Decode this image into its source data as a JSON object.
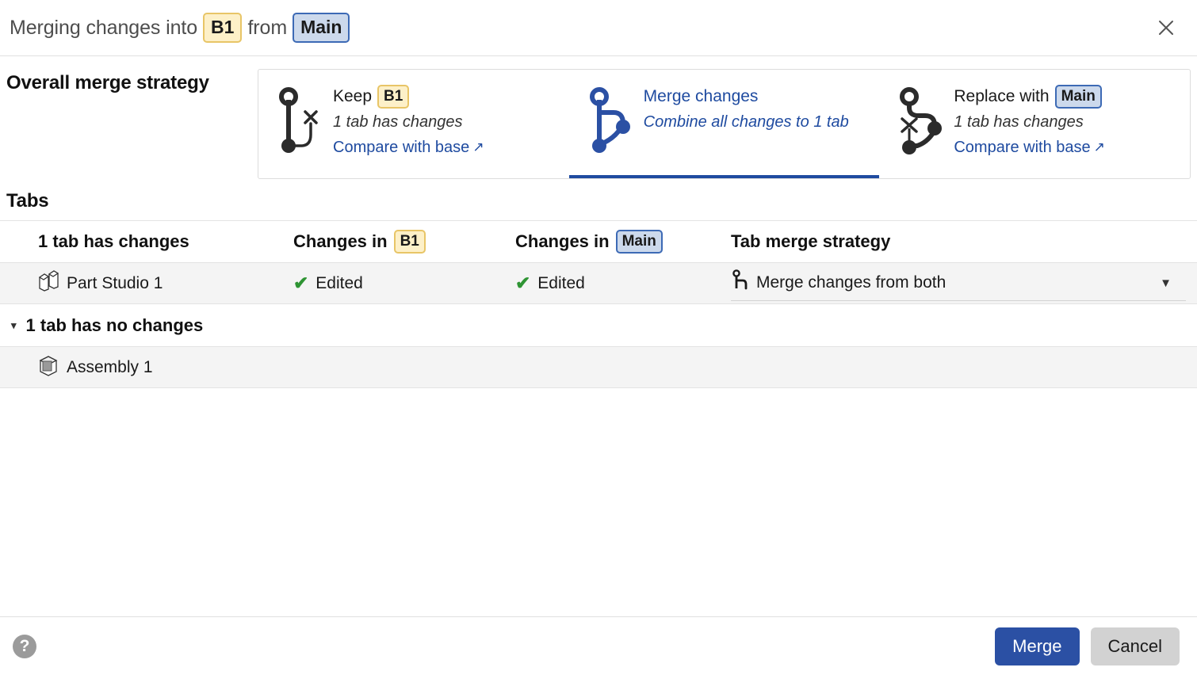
{
  "header": {
    "prefix": "Merging changes into",
    "target_branch": "B1",
    "middle": "from",
    "source_branch": "Main",
    "close_icon": "close-icon"
  },
  "strategy": {
    "label": "Overall merge strategy",
    "options": [
      {
        "id": "keep-b1",
        "title_prefix": "Keep",
        "badge": "B1",
        "badge_style": "yellow",
        "subtitle": "1 tab has changes",
        "link": "Compare with base",
        "link_arrow": "↗",
        "selected": false,
        "icon": "branch-discard-right-icon"
      },
      {
        "id": "merge-changes",
        "title_prefix": "Merge changes",
        "badge": "",
        "badge_style": "none",
        "subtitle": "Combine all changes to 1 tab",
        "link": "",
        "link_arrow": "",
        "selected": true,
        "icon": "branch-merge-icon"
      },
      {
        "id": "replace-with-main",
        "title_prefix": "Replace with",
        "badge": "Main",
        "badge_style": "blue",
        "subtitle": "1 tab has changes",
        "link": "Compare with base",
        "link_arrow": "↗",
        "selected": false,
        "icon": "branch-discard-left-icon"
      }
    ]
  },
  "tabs_section": {
    "heading": "Tabs",
    "columns": {
      "c1": "1 tab has changes",
      "c2_prefix": "Changes in",
      "c2_badge": "B1",
      "c3_prefix": "Changes in",
      "c3_badge": "Main",
      "c4": "Tab merge strategy"
    },
    "changed_rows": [
      {
        "name": "Part Studio 1",
        "icon": "part-studio-icon",
        "change_b1": "Edited",
        "change_main": "Edited",
        "status_icon": "check-icon",
        "strategy": "Merge changes from both",
        "strategy_icon": "branch-merge-small-icon",
        "caret": "▼"
      }
    ],
    "no_changes_group": {
      "label": "1 tab has no changes",
      "expanded": true,
      "triangle": "▾",
      "rows": [
        {
          "name": "Assembly 1",
          "icon": "assembly-icon"
        }
      ]
    }
  },
  "footer": {
    "help_glyph": "?",
    "merge_label": "Merge",
    "cancel_label": "Cancel"
  },
  "colors": {
    "accent_blue": "#1f4ba0",
    "primary_button": "#2b50a4",
    "check_green": "#2e9433",
    "badge_yellow_bg": "#fdf0c8",
    "badge_yellow_border": "#e8c567",
    "badge_blue_bg": "#ccd9ec",
    "badge_blue_border": "#3d6ab5",
    "row_bg": "#f4f4f4"
  }
}
